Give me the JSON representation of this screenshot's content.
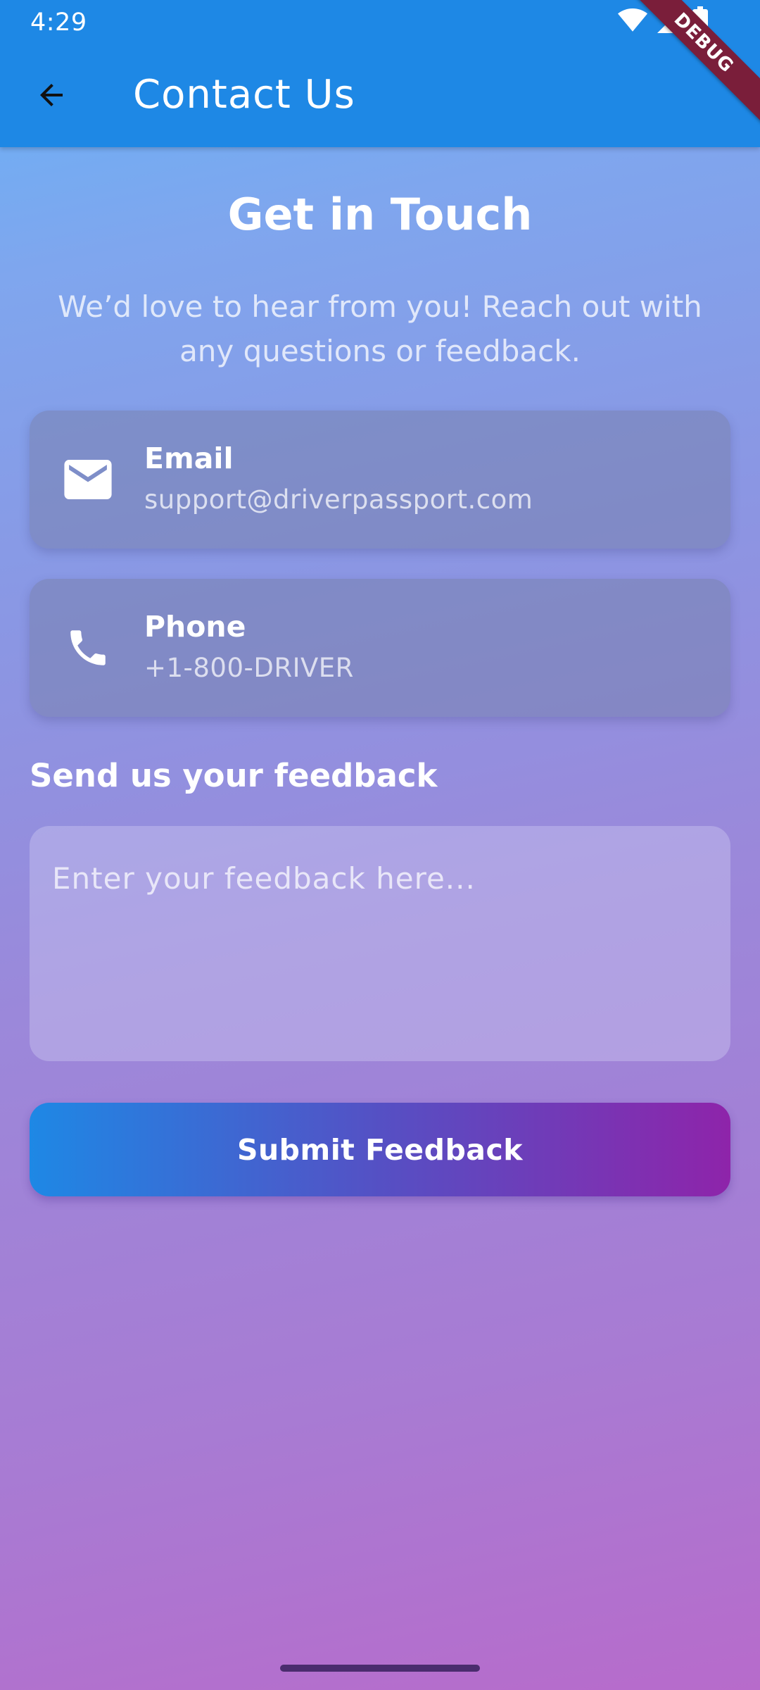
{
  "status_bar": {
    "time": "4:29",
    "icons": [
      "wifi-icon",
      "cellular-signal-icon",
      "battery-icon"
    ]
  },
  "debug_banner": "DEBUG",
  "app_bar": {
    "back_icon": "arrow-back-icon",
    "title": "Contact Us",
    "color": "#1e88e5"
  },
  "main": {
    "heading": "Get in Touch",
    "subheading": "We’d love to hear from you! Reach out with any questions or feedback."
  },
  "contacts": [
    {
      "icon": "mail-icon",
      "title": "Email",
      "value": "support@driverpassport.com"
    },
    {
      "icon": "phone-icon",
      "title": "Phone",
      "value": "+1-800-DRIVER"
    }
  ],
  "feedback": {
    "label": "Send us your feedback",
    "placeholder": "Enter your feedback here...",
    "value": ""
  },
  "submit": {
    "label": "Submit Feedback",
    "gradient": [
      "#1e88e5",
      "#8e24aa"
    ]
  }
}
